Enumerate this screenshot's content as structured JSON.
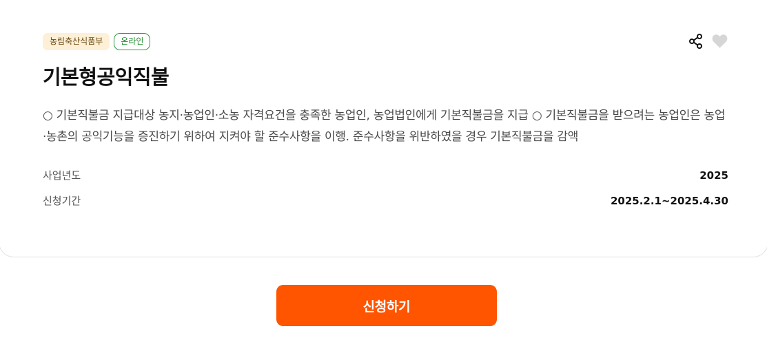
{
  "tags": {
    "ministry": "농림축산식품부",
    "mode": "온라인"
  },
  "title": "기본형공익직불",
  "description": "○ 기본직불금 지급대상 농지·농업인·소농 자격요건을 충족한 농업인, 농업법인에게 기본직불금을 지급 ○ 기본직불금을 받으려는 농업인은 농업·농촌의 공익기능을 증진하기 위하여 지켜야 할 준수사항을 이행. 준수사항을 위반하였을 경우 기본직불금을 감액",
  "info": {
    "year_label": "사업년도",
    "year_value": "2025",
    "period_label": "신청기간",
    "period_value": "2025.2.1~2025.4.30"
  },
  "apply_label": "신청하기",
  "icons": {
    "share": "share-icon",
    "like": "heart-icon"
  },
  "colors": {
    "accent": "#ff5400",
    "tag_bg": "#fdf0d7",
    "tag_online": "#2a9a3a",
    "heart": "#d6d6d6"
  }
}
